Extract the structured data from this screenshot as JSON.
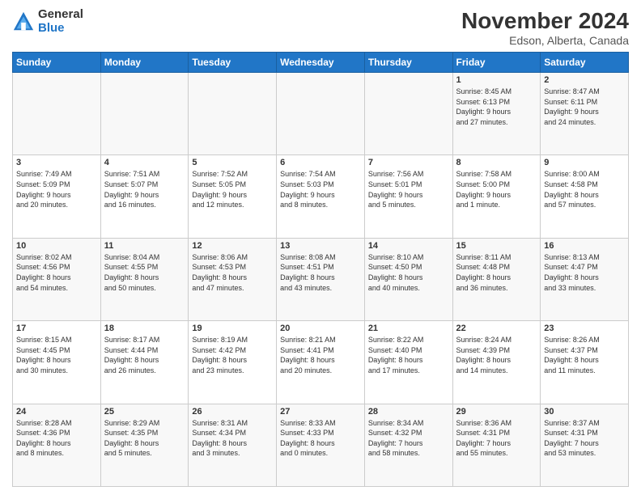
{
  "logo": {
    "general": "General",
    "blue": "Blue"
  },
  "header": {
    "month": "November 2024",
    "location": "Edson, Alberta, Canada"
  },
  "weekdays": [
    "Sunday",
    "Monday",
    "Tuesday",
    "Wednesday",
    "Thursday",
    "Friday",
    "Saturday"
  ],
  "weeks": [
    [
      {
        "day": "",
        "info": ""
      },
      {
        "day": "",
        "info": ""
      },
      {
        "day": "",
        "info": ""
      },
      {
        "day": "",
        "info": ""
      },
      {
        "day": "",
        "info": ""
      },
      {
        "day": "1",
        "info": "Sunrise: 8:45 AM\nSunset: 6:13 PM\nDaylight: 9 hours\nand 27 minutes."
      },
      {
        "day": "2",
        "info": "Sunrise: 8:47 AM\nSunset: 6:11 PM\nDaylight: 9 hours\nand 24 minutes."
      }
    ],
    [
      {
        "day": "3",
        "info": "Sunrise: 7:49 AM\nSunset: 5:09 PM\nDaylight: 9 hours\nand 20 minutes."
      },
      {
        "day": "4",
        "info": "Sunrise: 7:51 AM\nSunset: 5:07 PM\nDaylight: 9 hours\nand 16 minutes."
      },
      {
        "day": "5",
        "info": "Sunrise: 7:52 AM\nSunset: 5:05 PM\nDaylight: 9 hours\nand 12 minutes."
      },
      {
        "day": "6",
        "info": "Sunrise: 7:54 AM\nSunset: 5:03 PM\nDaylight: 9 hours\nand 8 minutes."
      },
      {
        "day": "7",
        "info": "Sunrise: 7:56 AM\nSunset: 5:01 PM\nDaylight: 9 hours\nand 5 minutes."
      },
      {
        "day": "8",
        "info": "Sunrise: 7:58 AM\nSunset: 5:00 PM\nDaylight: 9 hours\nand 1 minute."
      },
      {
        "day": "9",
        "info": "Sunrise: 8:00 AM\nSunset: 4:58 PM\nDaylight: 8 hours\nand 57 minutes."
      }
    ],
    [
      {
        "day": "10",
        "info": "Sunrise: 8:02 AM\nSunset: 4:56 PM\nDaylight: 8 hours\nand 54 minutes."
      },
      {
        "day": "11",
        "info": "Sunrise: 8:04 AM\nSunset: 4:55 PM\nDaylight: 8 hours\nand 50 minutes."
      },
      {
        "day": "12",
        "info": "Sunrise: 8:06 AM\nSunset: 4:53 PM\nDaylight: 8 hours\nand 47 minutes."
      },
      {
        "day": "13",
        "info": "Sunrise: 8:08 AM\nSunset: 4:51 PM\nDaylight: 8 hours\nand 43 minutes."
      },
      {
        "day": "14",
        "info": "Sunrise: 8:10 AM\nSunset: 4:50 PM\nDaylight: 8 hours\nand 40 minutes."
      },
      {
        "day": "15",
        "info": "Sunrise: 8:11 AM\nSunset: 4:48 PM\nDaylight: 8 hours\nand 36 minutes."
      },
      {
        "day": "16",
        "info": "Sunrise: 8:13 AM\nSunset: 4:47 PM\nDaylight: 8 hours\nand 33 minutes."
      }
    ],
    [
      {
        "day": "17",
        "info": "Sunrise: 8:15 AM\nSunset: 4:45 PM\nDaylight: 8 hours\nand 30 minutes."
      },
      {
        "day": "18",
        "info": "Sunrise: 8:17 AM\nSunset: 4:44 PM\nDaylight: 8 hours\nand 26 minutes."
      },
      {
        "day": "19",
        "info": "Sunrise: 8:19 AM\nSunset: 4:42 PM\nDaylight: 8 hours\nand 23 minutes."
      },
      {
        "day": "20",
        "info": "Sunrise: 8:21 AM\nSunset: 4:41 PM\nDaylight: 8 hours\nand 20 minutes."
      },
      {
        "day": "21",
        "info": "Sunrise: 8:22 AM\nSunset: 4:40 PM\nDaylight: 8 hours\nand 17 minutes."
      },
      {
        "day": "22",
        "info": "Sunrise: 8:24 AM\nSunset: 4:39 PM\nDaylight: 8 hours\nand 14 minutes."
      },
      {
        "day": "23",
        "info": "Sunrise: 8:26 AM\nSunset: 4:37 PM\nDaylight: 8 hours\nand 11 minutes."
      }
    ],
    [
      {
        "day": "24",
        "info": "Sunrise: 8:28 AM\nSunset: 4:36 PM\nDaylight: 8 hours\nand 8 minutes."
      },
      {
        "day": "25",
        "info": "Sunrise: 8:29 AM\nSunset: 4:35 PM\nDaylight: 8 hours\nand 5 minutes."
      },
      {
        "day": "26",
        "info": "Sunrise: 8:31 AM\nSunset: 4:34 PM\nDaylight: 8 hours\nand 3 minutes."
      },
      {
        "day": "27",
        "info": "Sunrise: 8:33 AM\nSunset: 4:33 PM\nDaylight: 8 hours\nand 0 minutes."
      },
      {
        "day": "28",
        "info": "Sunrise: 8:34 AM\nSunset: 4:32 PM\nDaylight: 7 hours\nand 58 minutes."
      },
      {
        "day": "29",
        "info": "Sunrise: 8:36 AM\nSunset: 4:31 PM\nDaylight: 7 hours\nand 55 minutes."
      },
      {
        "day": "30",
        "info": "Sunrise: 8:37 AM\nSunset: 4:31 PM\nDaylight: 7 hours\nand 53 minutes."
      }
    ]
  ]
}
